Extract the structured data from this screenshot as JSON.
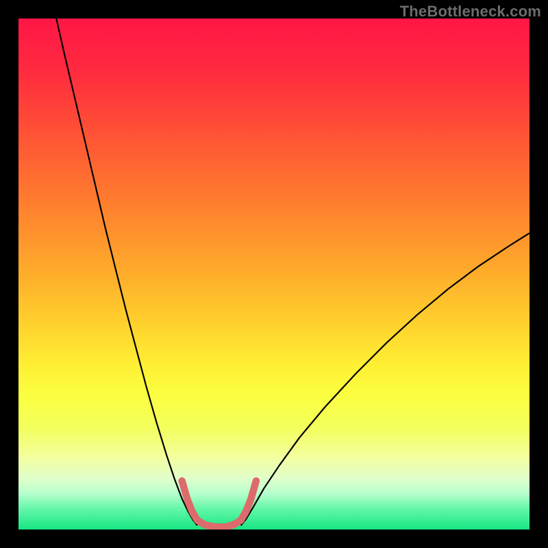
{
  "watermark": "TheBottleneck.com",
  "plot_size": 746,
  "gradient_stops": [
    {
      "offset": 0.0,
      "color": "#ff1646"
    },
    {
      "offset": 0.1,
      "color": "#ff2a3f"
    },
    {
      "offset": 0.2,
      "color": "#ff4a37"
    },
    {
      "offset": 0.3,
      "color": "#ff6a31"
    },
    {
      "offset": 0.4,
      "color": "#ff8b2d"
    },
    {
      "offset": 0.5,
      "color": "#ffad2b"
    },
    {
      "offset": 0.6,
      "color": "#ffd22d"
    },
    {
      "offset": 0.68,
      "color": "#fff034"
    },
    {
      "offset": 0.74,
      "color": "#fbff41"
    },
    {
      "offset": 0.8,
      "color": "#f3ff5c"
    },
    {
      "offset": 0.86,
      "color": "#f3ffa0"
    },
    {
      "offset": 0.9,
      "color": "#e1ffcb"
    },
    {
      "offset": 0.93,
      "color": "#b6ffcc"
    },
    {
      "offset": 0.96,
      "color": "#62f7a8"
    },
    {
      "offset": 1.0,
      "color": "#18e583"
    }
  ],
  "chart_data": {
    "type": "line",
    "title": "",
    "xlabel": "",
    "ylabel": "",
    "xlim": [
      0,
      100
    ],
    "ylim": [
      0,
      100
    ],
    "series": [
      {
        "name": "left-curve",
        "stroke": "#000000",
        "width": 2.2,
        "x": [
          7.4,
          9.0,
          11.0,
          13.0,
          15.0,
          17.0,
          19.0,
          21.0,
          23.0,
          25.0,
          27.0,
          29.0,
          30.5,
          32.0,
          33.2,
          34.2,
          35.0
        ],
        "values": [
          100.0,
          93.0,
          84.5,
          76.0,
          67.5,
          59.0,
          51.0,
          43.0,
          35.5,
          28.0,
          21.0,
          14.5,
          10.0,
          6.0,
          3.5,
          1.8,
          0.8
        ]
      },
      {
        "name": "right-curve",
        "stroke": "#000000",
        "width": 2.2,
        "x": [
          43.5,
          44.5,
          46.0,
          48.0,
          51.0,
          55.0,
          60.0,
          66.0,
          72.0,
          78.0,
          84.0,
          90.0,
          96.0,
          100.0
        ],
        "values": [
          0.8,
          2.0,
          4.5,
          8.0,
          12.5,
          18.0,
          24.0,
          30.5,
          36.5,
          42.0,
          47.0,
          51.5,
          55.5,
          58.0
        ]
      },
      {
        "name": "floor-marker",
        "stroke": "#dd6b6b",
        "width": 10.5,
        "linecap": "round",
        "x": [
          32.0,
          33.0,
          34.0,
          35.0,
          36.5,
          38.5,
          40.5,
          42.0,
          43.5,
          44.5,
          45.5,
          46.5
        ],
        "values": [
          9.5,
          6.0,
          3.5,
          1.8,
          0.9,
          0.5,
          0.5,
          0.9,
          1.8,
          3.5,
          6.0,
          9.5
        ]
      }
    ]
  }
}
